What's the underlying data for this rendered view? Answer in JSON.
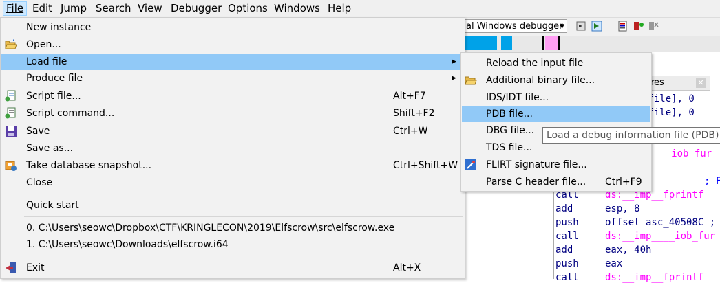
{
  "menubar": {
    "items": [
      "File",
      "Edit",
      "Jump",
      "Search",
      "View",
      "Debugger",
      "Options",
      "Windows",
      "Help"
    ]
  },
  "toolbar": {
    "debugger_select": "al Windows debugger"
  },
  "background": {
    "tab_label": "res",
    "code_lines": [
      {
        "op": "",
        "arg": "_file], 0"
      },
      {
        "op": "",
        "arg": "_file], 0"
      },
      {
        "op": "",
        "arg": "c____iob_fur"
      },
      {
        "op": "",
        "arg": "; F"
      },
      {
        "op": "call",
        "arg": "ds:__imp__fprintf"
      },
      {
        "op": "add",
        "arg": "esp, 8"
      },
      {
        "op": "push",
        "arg": "offset asc_40508C ;"
      },
      {
        "op": "call",
        "arg": "ds:__imp____iob_fur"
      },
      {
        "op": "add",
        "arg": "eax, 40h"
      },
      {
        "op": "push",
        "arg": "eax"
      },
      {
        "op": "call",
        "arg": "ds:__imp__fprintf"
      }
    ]
  },
  "file_menu": {
    "items": [
      {
        "label": "New instance",
        "shortcut": "",
        "icon": "",
        "submenu": false
      },
      {
        "label": "Open...",
        "shortcut": "",
        "icon": "folder-open-icon",
        "submenu": false
      },
      {
        "label": "Load file",
        "shortcut": "",
        "icon": "",
        "submenu": true
      },
      {
        "label": "Produce file",
        "shortcut": "",
        "icon": "",
        "submenu": true
      },
      {
        "label": "Script file...",
        "shortcut": "Alt+F7",
        "icon": "script-file-icon",
        "submenu": false
      },
      {
        "label": "Script command...",
        "shortcut": "Shift+F2",
        "icon": "script-command-icon",
        "submenu": false
      },
      {
        "label": "Save",
        "shortcut": "Ctrl+W",
        "icon": "save-icon",
        "submenu": false
      },
      {
        "label": "Save as...",
        "shortcut": "",
        "icon": "",
        "submenu": false
      },
      {
        "label": "Take database snapshot...",
        "shortcut": "Ctrl+Shift+W",
        "icon": "snapshot-icon",
        "submenu": false
      },
      {
        "label": "Close",
        "shortcut": "",
        "icon": "",
        "submenu": false
      },
      {
        "label": "Quick start",
        "shortcut": "",
        "icon": "",
        "submenu": false
      },
      {
        "label": "0. C:\\Users\\seowc\\Dropbox\\CTF\\KRINGLECON\\2019\\Elfscrow\\src\\elfscrow.exe",
        "shortcut": "",
        "icon": "",
        "submenu": false
      },
      {
        "label": "1. C:\\Users\\seowc\\Downloads\\elfscrow.i64",
        "shortcut": "",
        "icon": "",
        "submenu": false
      },
      {
        "label": "Exit",
        "shortcut": "Alt+X",
        "icon": "exit-icon",
        "submenu": false
      }
    ],
    "highlighted": "Load file"
  },
  "load_submenu": {
    "items": [
      {
        "label": "Reload the input file",
        "shortcut": "",
        "icon": ""
      },
      {
        "label": "Additional binary file...",
        "shortcut": "",
        "icon": "folder-open-icon"
      },
      {
        "label": "IDS/IDT file...",
        "shortcut": "",
        "icon": ""
      },
      {
        "label": "PDB file...",
        "shortcut": "",
        "icon": ""
      },
      {
        "label": "DBG file...",
        "shortcut": "",
        "icon": ""
      },
      {
        "label": "TDS file...",
        "shortcut": "",
        "icon": ""
      },
      {
        "label": "FLIRT signature file...",
        "shortcut": "",
        "icon": "flirt-icon"
      },
      {
        "label": "Parse C header file...",
        "shortcut": "Ctrl+F9",
        "icon": ""
      }
    ],
    "highlighted": "PDB file..."
  },
  "tooltip": {
    "text": "Load a debug information file (PDB)"
  },
  "colors": {
    "highlight": "#91c9f7",
    "menu_bg": "#f2f2f2",
    "menubar_active": "#cce8ff",
    "nav_blue": "#00a2e8",
    "nav_pink": "#ff9ff3",
    "asm_symbol": "#ff00ff"
  }
}
